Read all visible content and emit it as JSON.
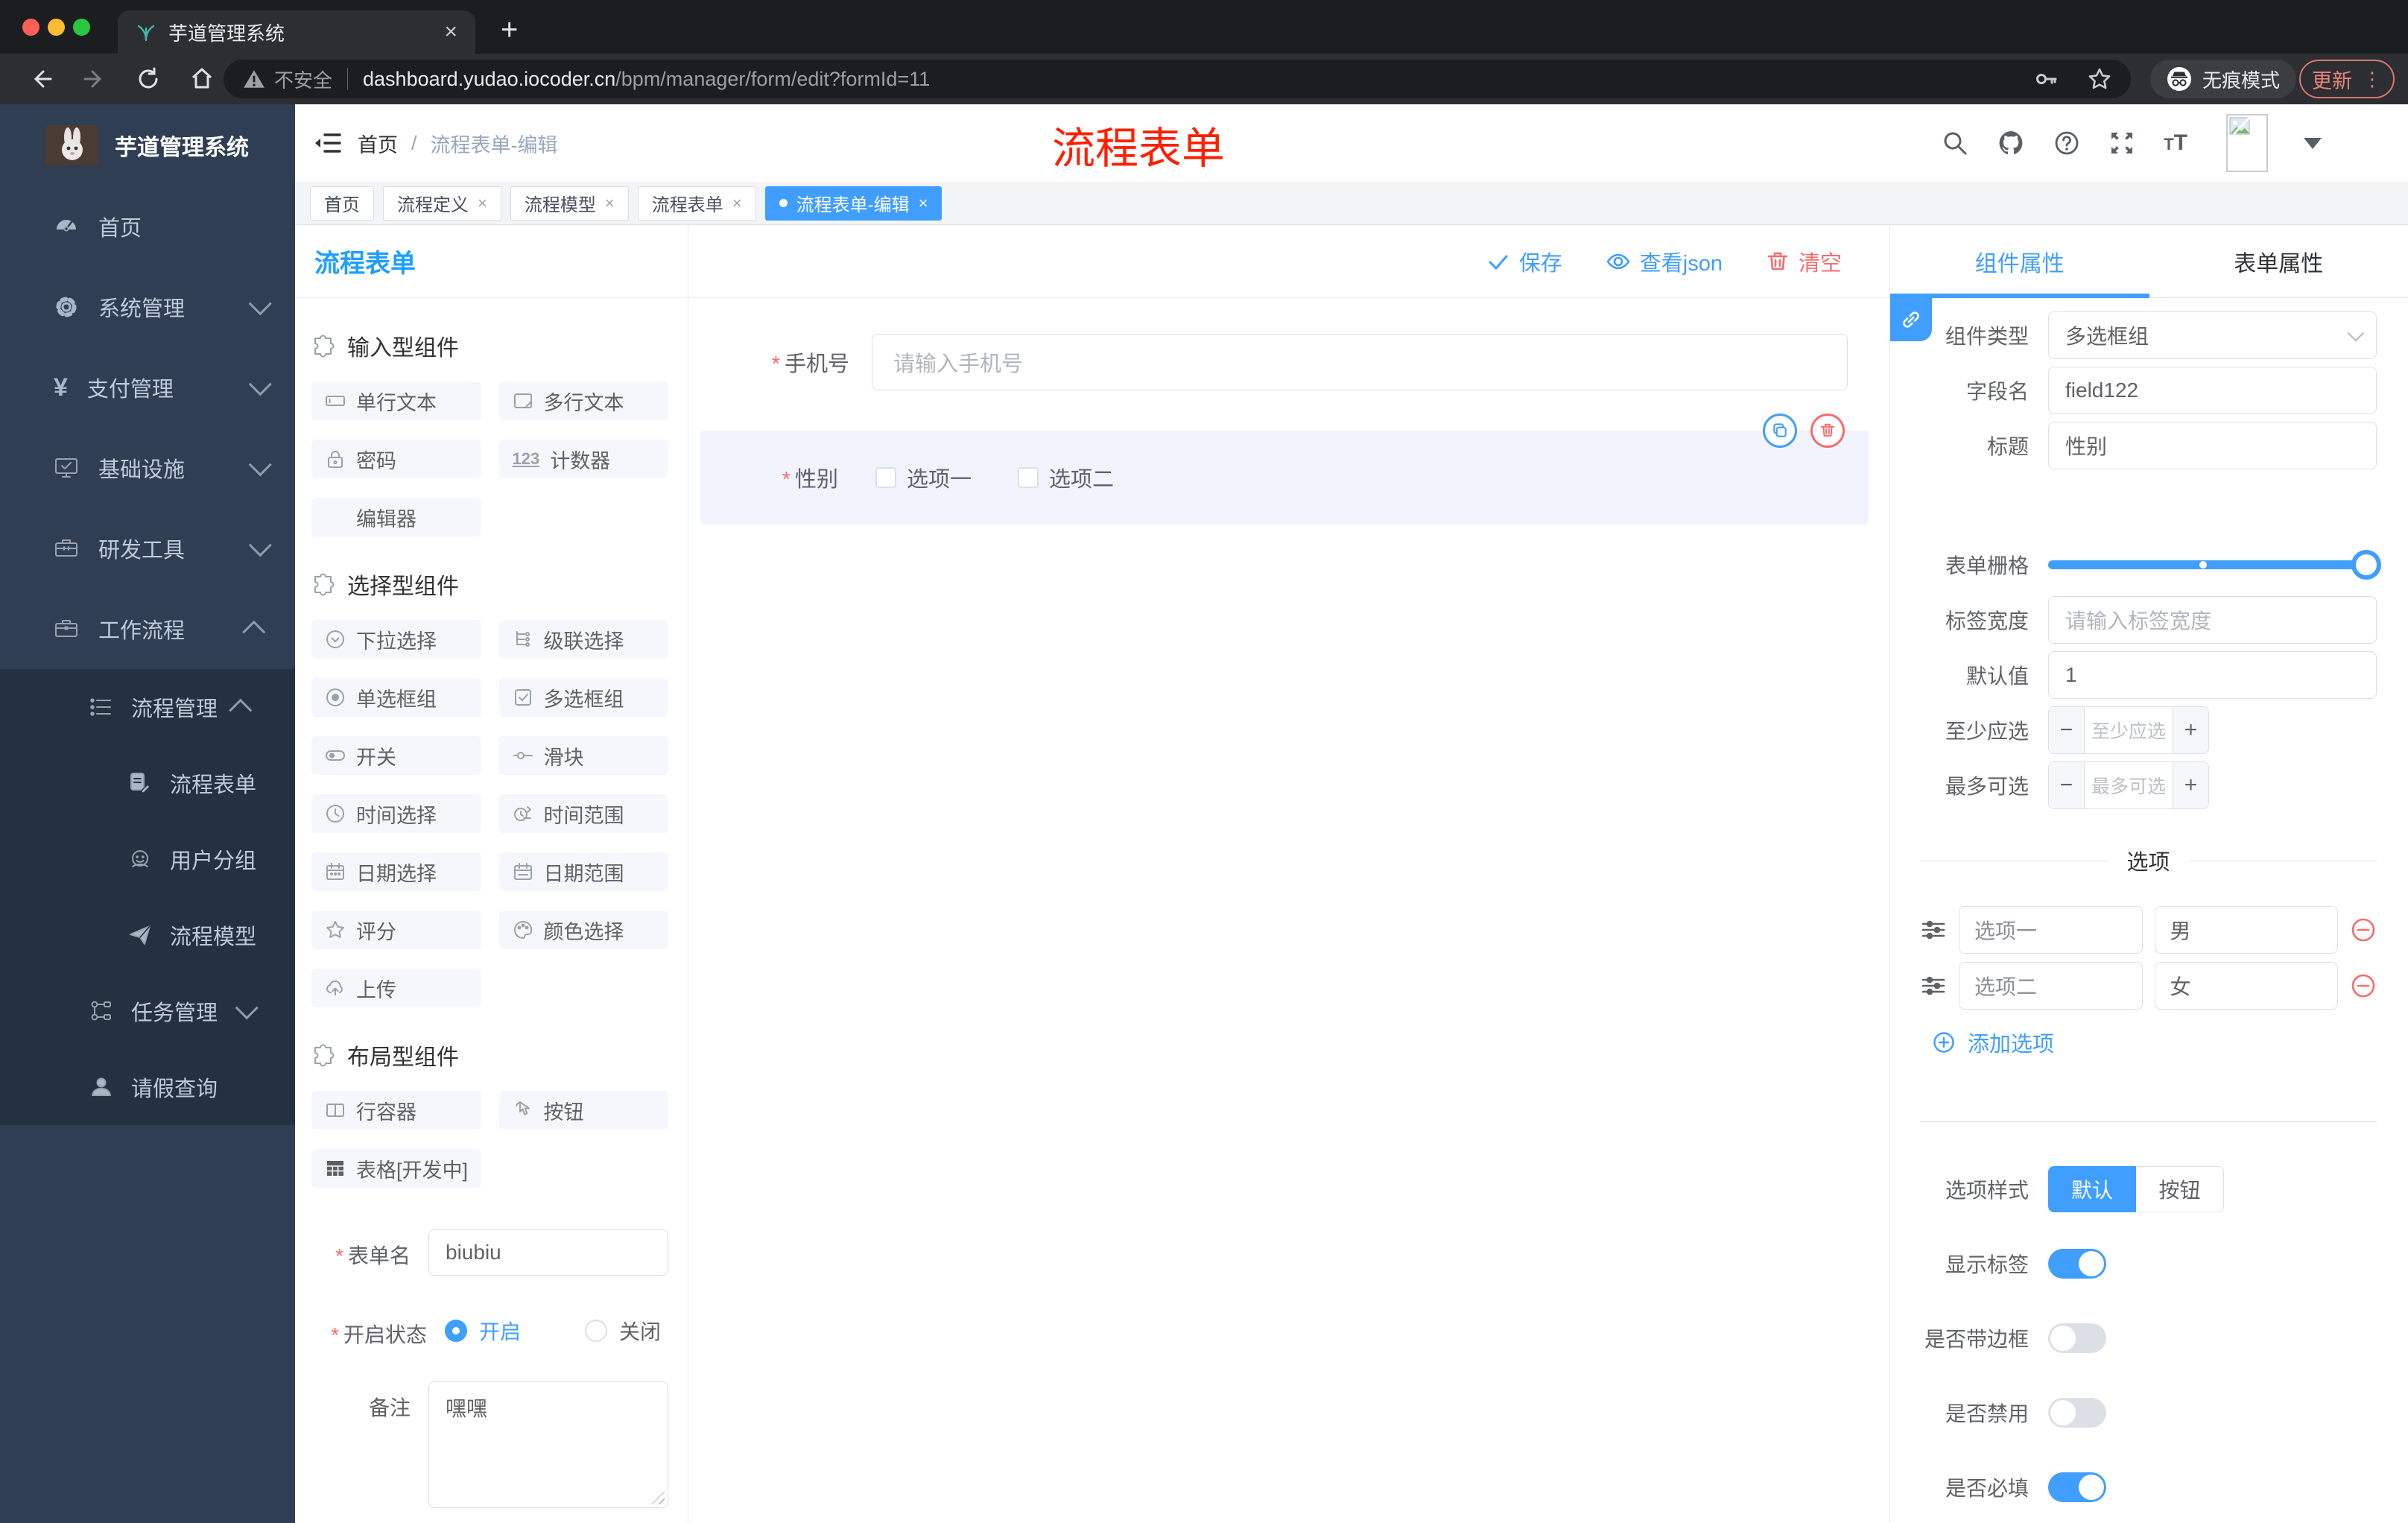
{
  "browser": {
    "tab_title": "芋道管理系统",
    "close_glyph": "×",
    "new_tab_glyph": "+",
    "security_label": "不安全",
    "url_host": "dashboard.yudao.iocoder.cn",
    "url_path": "/bpm/manager/form/edit?formId=11",
    "incognito_label": "无痕模式",
    "update_label": "更新",
    "kebab_glyph": "⋮"
  },
  "sidebar": {
    "logo_title": "芋道管理系统",
    "items": [
      {
        "label": "首页"
      },
      {
        "label": "系统管理"
      },
      {
        "label": "支付管理"
      },
      {
        "label": "基础设施"
      },
      {
        "label": "研发工具"
      },
      {
        "label": "工作流程"
      }
    ],
    "submenu": {
      "group": {
        "label": "流程管理"
      },
      "children": [
        {
          "label": "流程表单"
        },
        {
          "label": "用户分组"
        },
        {
          "label": "流程模型"
        }
      ],
      "tasks": {
        "label": "任务管理"
      },
      "leave": {
        "label": "请假查询"
      }
    }
  },
  "header": {
    "breadcrumb": {
      "first": "首页",
      "sep": "/",
      "current": "流程表单-编辑"
    },
    "annotation": "流程表单"
  },
  "route_tabs": {
    "tabs": [
      {
        "label": "首页"
      },
      {
        "label": "流程定义"
      },
      {
        "label": "流程模型"
      },
      {
        "label": "流程表单"
      },
      {
        "label": "流程表单-编辑"
      }
    ],
    "close_glyph": "×"
  },
  "designer": {
    "panel_title": "流程表单",
    "toolbar": {
      "save": "保存",
      "view_json": "查看json",
      "clear": "清空"
    },
    "palette": {
      "sections": [
        {
          "title": "输入型组件",
          "items": [
            "单行文本",
            "多行文本",
            "密码",
            "计数器",
            "编辑器"
          ]
        },
        {
          "title": "选择型组件",
          "items": [
            "下拉选择",
            "级联选择",
            "单选框组",
            "多选框组",
            "开关",
            "滑块",
            "时间选择",
            "时间范围",
            "日期选择",
            "日期范围",
            "评分",
            "颜色选择",
            "上传"
          ]
        },
        {
          "title": "布局型组件",
          "items": [
            "行容器",
            "按钮",
            "表格[开发中]"
          ]
        }
      ],
      "counter_icon_text": "123"
    },
    "meta_form": {
      "name_label": "表单名",
      "name_value": "biubiu",
      "status_label": "开启状态",
      "status_on": "开启",
      "status_off": "关闭",
      "remark_label": "备注",
      "remark_value": "嘿嘿"
    }
  },
  "canvas": {
    "phone": {
      "label": "手机号",
      "placeholder": "请输入手机号"
    },
    "gender": {
      "label": "性别",
      "option1": "选项一",
      "option2": "选项二"
    }
  },
  "inspector": {
    "tabs": {
      "component": "组件属性",
      "form": "表单属性"
    },
    "rows": {
      "type_label": "组件类型",
      "type_value": "多选框组",
      "field_label": "字段名",
      "field_value": "field122",
      "title_label": "标题",
      "title_value": "性别",
      "grid_label": "表单栅格",
      "label_width_label": "标签宽度",
      "label_width_placeholder": "请输入标签宽度",
      "default_label": "默认值",
      "default_value": "1",
      "min_label": "至少应选",
      "min_placeholder": "至少应选",
      "max_label": "最多可选",
      "max_placeholder": "最多可选"
    },
    "options": {
      "divider_title": "选项",
      "rows": [
        {
          "label": "选项一",
          "value": "男"
        },
        {
          "label": "选项二",
          "value": "女"
        }
      ],
      "add_label": "添加选项"
    },
    "style": {
      "style_label": "选项样式",
      "style_default": "默认",
      "style_button": "按钮",
      "show_label": "显示标签",
      "border_label": "是否带边框",
      "disabled_label": "是否禁用",
      "required_label": "是否必填"
    }
  },
  "colors": {
    "primary": "#409eff",
    "danger": "#f56c6c",
    "annotation": "#ff1f00",
    "sidebar": "#2f3e52"
  }
}
